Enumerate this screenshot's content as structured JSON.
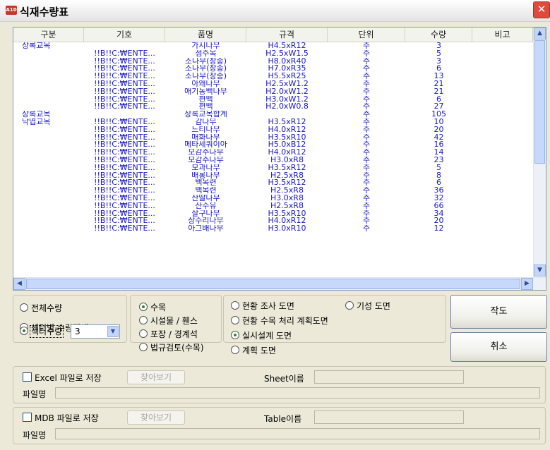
{
  "window": {
    "title": "식재수량표",
    "icon_text": "A10",
    "close_glyph": "✕"
  },
  "grid": {
    "headers": [
      "구분",
      "기호",
      "품명",
      "규격",
      "단위",
      "수량",
      "비고"
    ],
    "rows": [
      {
        "category": "상록교목",
        "symbol": "",
        "name": "가시나무",
        "spec": "H4.5xR12",
        "unit": "주",
        "qty": "3"
      },
      {
        "category": "",
        "symbol": "!!B!!C:₩ENTE...",
        "name": "섬주목",
        "spec": "H2.5xW1.5",
        "unit": "주",
        "qty": "5"
      },
      {
        "category": "",
        "symbol": "!!B!!C:₩ENTE...",
        "name": "소나무(장송)",
        "spec": "H8.0xR40",
        "unit": "주",
        "qty": "3"
      },
      {
        "category": "",
        "symbol": "!!B!!C:₩ENTE...",
        "name": "소나무(장송)",
        "spec": "H7.0xR35",
        "unit": "주",
        "qty": "6"
      },
      {
        "category": "",
        "symbol": "!!B!!C:₩ENTE...",
        "name": "소나무(장송)",
        "spec": "H5.5xR25",
        "unit": "주",
        "qty": "13"
      },
      {
        "category": "",
        "symbol": "!!B!!C:₩ENTE...",
        "name": "아왜나무",
        "spec": "H2.5xW1.2",
        "unit": "주",
        "qty": "21"
      },
      {
        "category": "",
        "symbol": "!!B!!C:₩ENTE...",
        "name": "애기동백나무",
        "spec": "H2.0xW1.2",
        "unit": "주",
        "qty": "21"
      },
      {
        "category": "",
        "symbol": "!!B!!C:₩ENTE...",
        "name": "편백",
        "spec": "H3.0xW1.2",
        "unit": "주",
        "qty": "6"
      },
      {
        "category": "",
        "symbol": "!!B!!C:₩ENTE...",
        "name": "편백",
        "spec": "H2.0xW0.8",
        "unit": "주",
        "qty": "27"
      },
      {
        "category": "상록교목",
        "symbol": "",
        "name": "상록교목합계",
        "spec": "",
        "unit": "주",
        "qty": "105"
      },
      {
        "category": "낙엽교목",
        "symbol": "!!B!!C:₩ENTE...",
        "name": "감나무",
        "spec": "H3.5xR12",
        "unit": "주",
        "qty": "10"
      },
      {
        "category": "",
        "symbol": "!!B!!C:₩ENTE...",
        "name": "느티나무",
        "spec": "H4.0xR12",
        "unit": "주",
        "qty": "20"
      },
      {
        "category": "",
        "symbol": "!!B!!C:₩ENTE...",
        "name": "매화나무",
        "spec": "H3.5xR10",
        "unit": "주",
        "qty": "42"
      },
      {
        "category": "",
        "symbol": "!!B!!C:₩ENTE...",
        "name": "메타세쿼이아",
        "spec": "H5.0xB12",
        "unit": "주",
        "qty": "16"
      },
      {
        "category": "",
        "symbol": "!!B!!C:₩ENTE...",
        "name": "모감주나무",
        "spec": "H4.0xR12",
        "unit": "주",
        "qty": "14"
      },
      {
        "category": "",
        "symbol": "!!B!!C:₩ENTE...",
        "name": "모감주나무",
        "spec": "H3.0xR8",
        "unit": "주",
        "qty": "23"
      },
      {
        "category": "",
        "symbol": "!!B!!C:₩ENTE...",
        "name": "모과나무",
        "spec": "H3.5xR12",
        "unit": "주",
        "qty": "5"
      },
      {
        "category": "",
        "symbol": "!!B!!C:₩ENTE...",
        "name": "배롱나무",
        "spec": "H2.5xR8",
        "unit": "주",
        "qty": "8"
      },
      {
        "category": "",
        "symbol": "!!B!!C:₩ENTE...",
        "name": "백목련",
        "spec": "H3.5xR12",
        "unit": "주",
        "qty": "6"
      },
      {
        "category": "",
        "symbol": "!!B!!C:₩ENTE...",
        "name": "백목련",
        "spec": "H2.5xR8",
        "unit": "주",
        "qty": "36"
      },
      {
        "category": "",
        "symbol": "!!B!!C:₩ENTE...",
        "name": "산딸나무",
        "spec": "H3.0xR8",
        "unit": "주",
        "qty": "32"
      },
      {
        "category": "",
        "symbol": "!!B!!C:₩ENTE...",
        "name": "산수유",
        "spec": "H2.5xR8",
        "unit": "주",
        "qty": "66"
      },
      {
        "category": "",
        "symbol": "!!B!!C:₩ENTE...",
        "name": "살구나무",
        "spec": "H3.5xR10",
        "unit": "주",
        "qty": "34"
      },
      {
        "category": "",
        "symbol": "!!B!!C:₩ENTE...",
        "name": "상수리나무",
        "spec": "H4.0xR12",
        "unit": "주",
        "qty": "20"
      },
      {
        "category": "",
        "symbol": "!!B!!C:₩ENTE...",
        "name": "아그배나무",
        "spec": "H3.0xR10",
        "unit": "주",
        "qty": "12"
      }
    ]
  },
  "options": {
    "total_qty": "전체수량",
    "sector_total": "섹터별 수량집계",
    "sector_qty": "섹터수량",
    "sector_value": "3",
    "tree": "수목",
    "facility": "시설물 / 휀스",
    "paving": "포장 / 경계석",
    "legal": "법규검토(수목)",
    "survey": "현황 조사 도면",
    "existing": "기성 도면",
    "plan_tree": "현황 수목 처리 계획도면",
    "detail": "실시설계 도면",
    "plan": "계획 도면"
  },
  "actions": {
    "draw": "작도",
    "cancel": "취소"
  },
  "excel": {
    "checkbox": "Excel 파일로 저장",
    "browse": "찾아보기",
    "sheet_label": "Sheet이름",
    "file_label": "파일명"
  },
  "mdb": {
    "checkbox": "MDB 파일로 저장",
    "browse": "찾아보기",
    "table_label": "Table이름",
    "file_label": "파일명"
  }
}
